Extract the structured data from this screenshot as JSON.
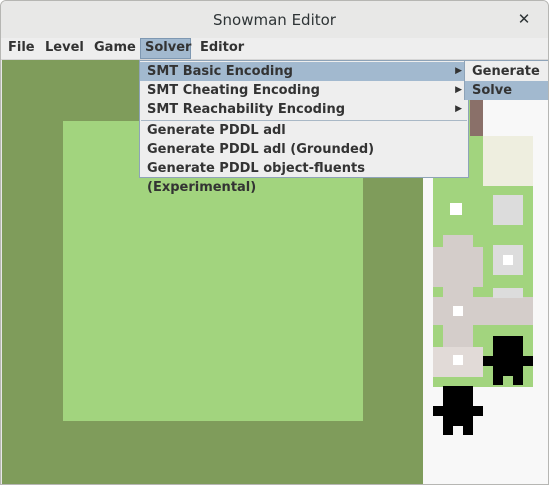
{
  "window": {
    "title": "Snowman Editor",
    "close_glyph": "✕"
  },
  "menubar": {
    "items": [
      "File",
      "Level",
      "Game",
      "Solver",
      "Editor"
    ],
    "active": "Solver"
  },
  "solver_menu": {
    "items": [
      {
        "label": "SMT Basic Encoding",
        "has_submenu": true,
        "highlighted": true
      },
      {
        "label": "SMT Cheating Encoding",
        "has_submenu": true
      },
      {
        "label": "SMT Reachability Encoding",
        "has_submenu": true
      },
      {
        "label": "Generate PDDL adl"
      },
      {
        "label": "Generate PDDL adl (Grounded)"
      },
      {
        "label": "Generate PDDL object-fluents (Experimental)"
      }
    ],
    "arrow_glyph": "▶"
  },
  "submenu": {
    "items": [
      {
        "label": "Generate"
      },
      {
        "label": "Solve",
        "highlighted": true
      }
    ]
  },
  "colors": {
    "dark_grass": "#7f9c5b",
    "light_grass": "#a2d47e",
    "snow": "#f8f8f8",
    "highlight": "#a2b9cf"
  }
}
